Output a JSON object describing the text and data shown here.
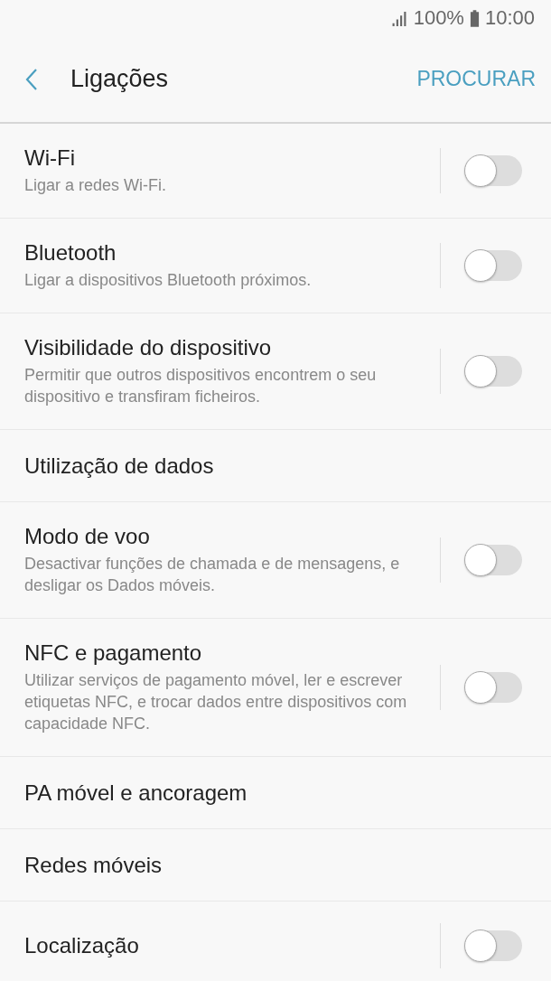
{
  "status_bar": {
    "battery": "100%",
    "time": "10:00"
  },
  "toolbar": {
    "title": "Ligações",
    "action": "PROCURAR"
  },
  "settings": [
    {
      "kind": "switch",
      "title": "Wi-Fi",
      "subtitle": "Ligar a redes Wi-Fi.",
      "on": false
    },
    {
      "kind": "switch",
      "title": "Bluetooth",
      "subtitle": "Ligar a dispositivos Bluetooth próximos.",
      "on": false
    },
    {
      "kind": "switch",
      "title": "Visibilidade do dispositivo",
      "subtitle": "Permitir que outros dispositivos encontrem o seu dispositivo e transfiram ficheiros.",
      "on": false
    },
    {
      "kind": "link",
      "title": "Utilização de dados"
    },
    {
      "kind": "switch",
      "title": "Modo de voo",
      "subtitle": "Desactivar funções de chamada e de mensagens, e desligar os Dados móveis.",
      "on": false
    },
    {
      "kind": "switch",
      "title": "NFC e pagamento",
      "subtitle": "Utilizar serviços de pagamento móvel, ler e escrever etiquetas NFC, e trocar dados entre dispositivos com capacidade NFC.",
      "on": false
    },
    {
      "kind": "link",
      "title": "PA móvel e ancoragem"
    },
    {
      "kind": "link",
      "title": "Redes móveis"
    },
    {
      "kind": "switch",
      "title": "Localização",
      "on": false
    }
  ]
}
